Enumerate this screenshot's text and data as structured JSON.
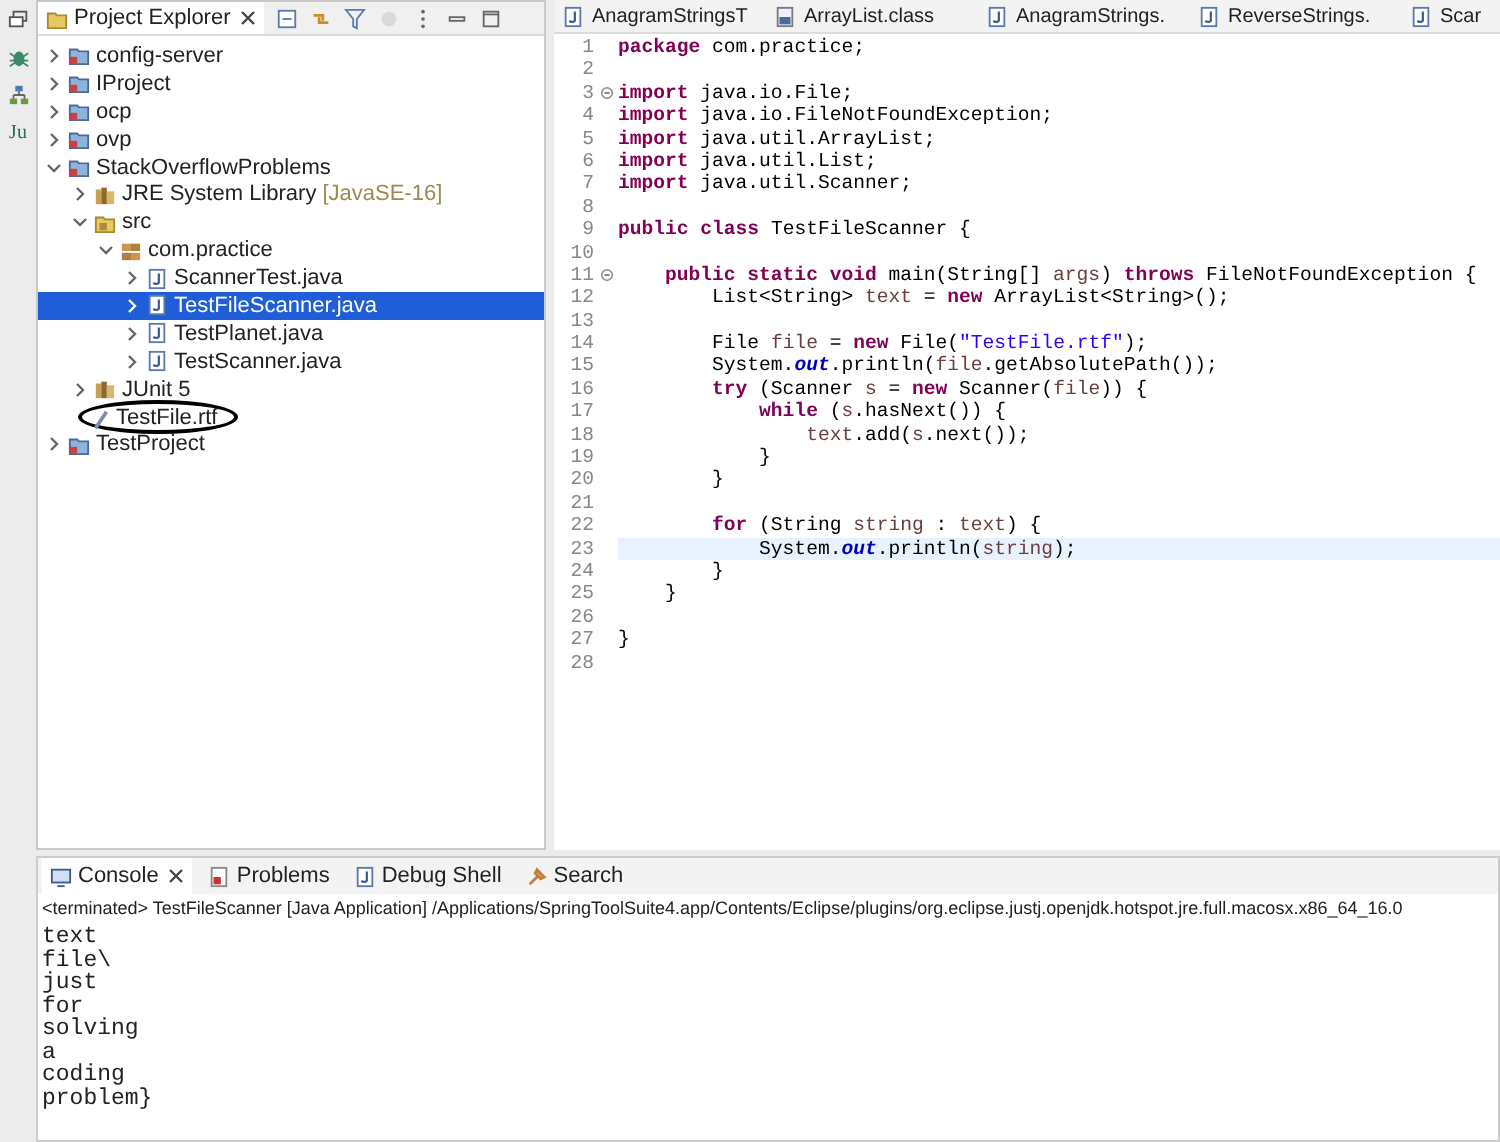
{
  "left_toolbar": [
    {
      "kind": "restore"
    },
    {
      "kind": "bug"
    },
    {
      "kind": "hierarchy"
    },
    {
      "kind": "junit",
      "label": "Ju"
    }
  ],
  "explorer": {
    "title": "Project Explorer",
    "tree": [
      {
        "label": "config-server",
        "kind": "project",
        "expanded": false,
        "selected": false
      },
      {
        "label": "IProject",
        "kind": "project",
        "expanded": false,
        "selected": false
      },
      {
        "label": "ocp",
        "kind": "project",
        "expanded": false,
        "selected": false
      },
      {
        "label": "ovp",
        "kind": "project",
        "expanded": false,
        "selected": false
      },
      {
        "label": "StackOverflowProblems",
        "kind": "project",
        "expanded": true,
        "selected": false,
        "children": [
          {
            "label": "JRE System Library",
            "decoration": "[JavaSE-16]",
            "kind": "library",
            "expanded": false,
            "selected": false
          },
          {
            "label": "src",
            "kind": "folder",
            "expanded": true,
            "selected": false,
            "children": [
              {
                "label": "com.practice",
                "kind": "package",
                "expanded": true,
                "selected": false,
                "children": [
                  {
                    "label": "ScannerTest.java",
                    "kind": "java",
                    "expanded": false,
                    "selected": false
                  },
                  {
                    "label": "TestFileScanner.java",
                    "kind": "java",
                    "expanded": false,
                    "selected": true
                  },
                  {
                    "label": "TestPlanet.java",
                    "kind": "java",
                    "expanded": false,
                    "selected": false
                  },
                  {
                    "label": "TestScanner.java",
                    "kind": "java",
                    "expanded": false,
                    "selected": false
                  }
                ]
              }
            ]
          },
          {
            "label": "JUnit 5",
            "kind": "library",
            "expanded": false,
            "selected": false
          },
          {
            "label": "TestFile.rtf",
            "kind": "file",
            "selected": false,
            "circled": true
          }
        ]
      },
      {
        "label": "TestProject",
        "kind": "project",
        "expanded": false,
        "selected": false
      }
    ]
  },
  "editor": {
    "tabs": [
      {
        "label": "AnagramStringsT",
        "kind": "java"
      },
      {
        "label": "ArrayList.class",
        "kind": "class"
      },
      {
        "label": "AnagramStrings.",
        "kind": "java"
      },
      {
        "label": "ReverseStrings.",
        "kind": "java"
      },
      {
        "label": "Scar",
        "kind": "java"
      }
    ],
    "lines": [
      {
        "number": "1",
        "fold": false,
        "current": false,
        "tokens": [
          {
            "kind": "keyword",
            "text": "package"
          },
          {
            "kind": "plain",
            "text": " com.practice;"
          }
        ]
      },
      {
        "number": "2",
        "fold": false,
        "current": false
      },
      {
        "number": "3",
        "fold": true,
        "current": false,
        "tokens": [
          {
            "kind": "keyword",
            "text": "import"
          },
          {
            "kind": "plain",
            "text": " java.io.File;"
          }
        ]
      },
      {
        "number": "4",
        "fold": false,
        "current": false,
        "tokens": [
          {
            "kind": "keyword",
            "text": "import"
          },
          {
            "kind": "plain",
            "text": " java.io.FileNotFoundException;"
          }
        ]
      },
      {
        "number": "5",
        "fold": false,
        "current": false,
        "tokens": [
          {
            "kind": "keyword",
            "text": "import"
          },
          {
            "kind": "plain",
            "text": " java.util.ArrayList;"
          }
        ]
      },
      {
        "number": "6",
        "fold": false,
        "current": false,
        "tokens": [
          {
            "kind": "keyword",
            "text": "import"
          },
          {
            "kind": "plain",
            "text": " java.util.List;"
          }
        ]
      },
      {
        "number": "7",
        "fold": false,
        "current": false,
        "tokens": [
          {
            "kind": "keyword",
            "text": "import"
          },
          {
            "kind": "plain",
            "text": " java.util.Scanner;"
          }
        ]
      },
      {
        "number": "8",
        "fold": false,
        "current": false
      },
      {
        "number": "9",
        "fold": false,
        "current": false,
        "tokens": [
          {
            "kind": "keyword",
            "text": "public class"
          },
          {
            "kind": "plain",
            "text": " TestFileScanner {"
          }
        ]
      },
      {
        "number": "10",
        "fold": false,
        "current": false
      },
      {
        "number": "11",
        "fold": true,
        "current": false,
        "tokens": [
          {
            "kind": "keyword",
            "text": "    public static void"
          },
          {
            "kind": "plain",
            "text": " main(String[] "
          },
          {
            "kind": "variable",
            "text": "args"
          },
          {
            "kind": "plain",
            "text": ") "
          },
          {
            "kind": "keyword",
            "text": "throws"
          },
          {
            "kind": "plain",
            "text": " FileNotFoundException {"
          }
        ]
      },
      {
        "number": "12",
        "fold": false,
        "current": false,
        "tokens": [
          {
            "kind": "plain",
            "text": "        List<String> "
          },
          {
            "kind": "variable",
            "text": "text"
          },
          {
            "kind": "plain",
            "text": " = "
          },
          {
            "kind": "keyword",
            "text": "new"
          },
          {
            "kind": "plain",
            "text": " ArrayList<String>();"
          }
        ]
      },
      {
        "number": "13",
        "fold": false,
        "current": false
      },
      {
        "number": "14",
        "fold": false,
        "current": false,
        "tokens": [
          {
            "kind": "plain",
            "text": "        File "
          },
          {
            "kind": "variable",
            "text": "file"
          },
          {
            "kind": "plain",
            "text": " = "
          },
          {
            "kind": "keyword",
            "text": "new"
          },
          {
            "kind": "plain",
            "text": " File("
          },
          {
            "kind": "string",
            "text": "\"TestFile.rtf\""
          },
          {
            "kind": "plain",
            "text": ");"
          }
        ]
      },
      {
        "number": "15",
        "fold": false,
        "current": false,
        "tokens": [
          {
            "kind": "plain",
            "text": "        System."
          },
          {
            "kind": "static",
            "text": "out"
          },
          {
            "kind": "plain",
            "text": ".println("
          },
          {
            "kind": "variable",
            "text": "file"
          },
          {
            "kind": "plain",
            "text": ".getAbsolutePath());"
          }
        ]
      },
      {
        "number": "16",
        "fold": false,
        "current": false,
        "tokens": [
          {
            "kind": "keyword",
            "text": "        try"
          },
          {
            "kind": "plain",
            "text": " (Scanner "
          },
          {
            "kind": "variable",
            "text": "s"
          },
          {
            "kind": "plain",
            "text": " = "
          },
          {
            "kind": "keyword",
            "text": "new"
          },
          {
            "kind": "plain",
            "text": " Scanner("
          },
          {
            "kind": "variable",
            "text": "file"
          },
          {
            "kind": "plain",
            "text": ")) {"
          }
        ]
      },
      {
        "number": "17",
        "fold": false,
        "current": false,
        "tokens": [
          {
            "kind": "keyword",
            "text": "            while"
          },
          {
            "kind": "plain",
            "text": " ("
          },
          {
            "kind": "variable",
            "text": "s"
          },
          {
            "kind": "plain",
            "text": ".hasNext()) {"
          }
        ]
      },
      {
        "number": "18",
        "fold": false,
        "current": false,
        "tokens": [
          {
            "kind": "variable",
            "text": "                text"
          },
          {
            "kind": "plain",
            "text": ".add("
          },
          {
            "kind": "variable",
            "text": "s"
          },
          {
            "kind": "plain",
            "text": ".next());"
          }
        ]
      },
      {
        "number": "19",
        "fold": false,
        "current": false,
        "tokens": [
          {
            "kind": "plain",
            "text": "            }"
          }
        ]
      },
      {
        "number": "20",
        "fold": false,
        "current": false,
        "tokens": [
          {
            "kind": "plain",
            "text": "        }"
          }
        ]
      },
      {
        "number": "21",
        "fold": false,
        "current": false
      },
      {
        "number": "22",
        "fold": false,
        "current": false,
        "tokens": [
          {
            "kind": "keyword",
            "text": "        for"
          },
          {
            "kind": "plain",
            "text": " (String "
          },
          {
            "kind": "variable",
            "text": "string"
          },
          {
            "kind": "plain",
            "text": " : "
          },
          {
            "kind": "variable",
            "text": "text"
          },
          {
            "kind": "plain",
            "text": ") {"
          }
        ]
      },
      {
        "number": "23",
        "fold": false,
        "current": true,
        "tokens": [
          {
            "kind": "plain",
            "text": "            System."
          },
          {
            "kind": "static",
            "text": "out"
          },
          {
            "kind": "plain",
            "text": ".println("
          },
          {
            "kind": "variable",
            "text": "string"
          },
          {
            "kind": "plain",
            "text": ");"
          }
        ]
      },
      {
        "number": "24",
        "fold": false,
        "current": false,
        "tokens": [
          {
            "kind": "plain",
            "text": "        }"
          }
        ]
      },
      {
        "number": "25",
        "fold": false,
        "current": false,
        "tokens": [
          {
            "kind": "plain",
            "text": "    }"
          }
        ]
      },
      {
        "number": "26",
        "fold": false,
        "current": false
      },
      {
        "number": "27",
        "fold": false,
        "current": false,
        "tokens": [
          {
            "kind": "plain",
            "text": "}"
          }
        ]
      },
      {
        "number": "28",
        "fold": false,
        "current": false
      }
    ]
  },
  "console": {
    "tabs": [
      {
        "label": "Console",
        "kind": "console",
        "selected": true
      },
      {
        "label": "Problems",
        "kind": "problems",
        "selected": false
      },
      {
        "label": "Debug Shell",
        "kind": "debug",
        "selected": false
      },
      {
        "label": "Search",
        "kind": "search",
        "selected": false
      }
    ],
    "header": "<terminated> TestFileScanner [Java Application] /Applications/SpringToolSuite4.app/Contents/Eclipse/plugins/org.eclipse.justj.openjdk.hotspot.jre.full.macosx.x86_64_16.0",
    "output": [
      "text",
      "file\\",
      "just",
      "for",
      "solving",
      "a",
      "coding",
      "problem}"
    ]
  }
}
